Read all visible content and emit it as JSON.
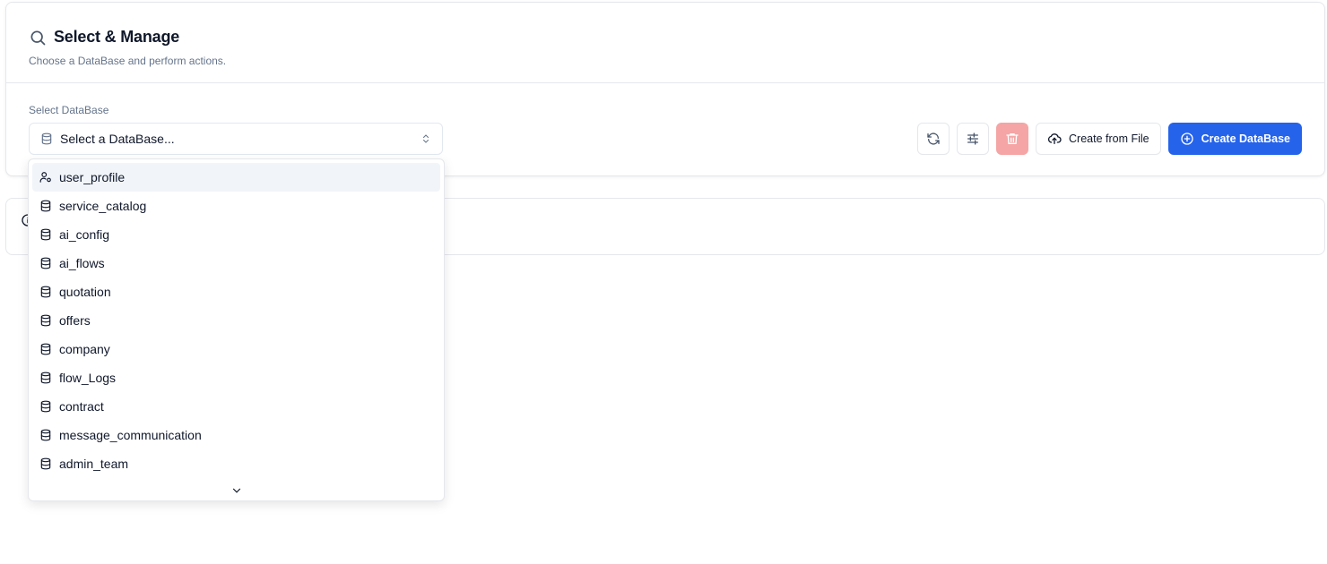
{
  "header": {
    "title": "Select & Manage",
    "subtitle": "Choose a DataBase and perform actions."
  },
  "select": {
    "label": "Select DataBase",
    "placeholder": "Select a DataBase..."
  },
  "actions": {
    "refresh": "refresh-icon",
    "settings": "sliders-icon",
    "delete": "trash-icon",
    "create_from_file": "Create from File",
    "create_database": "Create DataBase"
  },
  "dropdown": {
    "options": [
      {
        "label": "user_profile",
        "icon": "user-cog-icon"
      },
      {
        "label": "service_catalog",
        "icon": "database-icon"
      },
      {
        "label": "ai_config",
        "icon": "database-icon"
      },
      {
        "label": "ai_flows",
        "icon": "database-icon"
      },
      {
        "label": "quotation",
        "icon": "database-icon"
      },
      {
        "label": "offers",
        "icon": "database-icon"
      },
      {
        "label": "company",
        "icon": "database-icon"
      },
      {
        "label": "flow_Logs",
        "icon": "database-icon"
      },
      {
        "label": "contract",
        "icon": "database-icon"
      },
      {
        "label": "message_communication",
        "icon": "database-icon"
      },
      {
        "label": "admin_team",
        "icon": "database-icon"
      }
    ]
  },
  "colors": {
    "primary": "#2563eb",
    "danger_muted": "#f5a5a5",
    "muted_text": "#64748b",
    "border": "#e5e7eb"
  }
}
